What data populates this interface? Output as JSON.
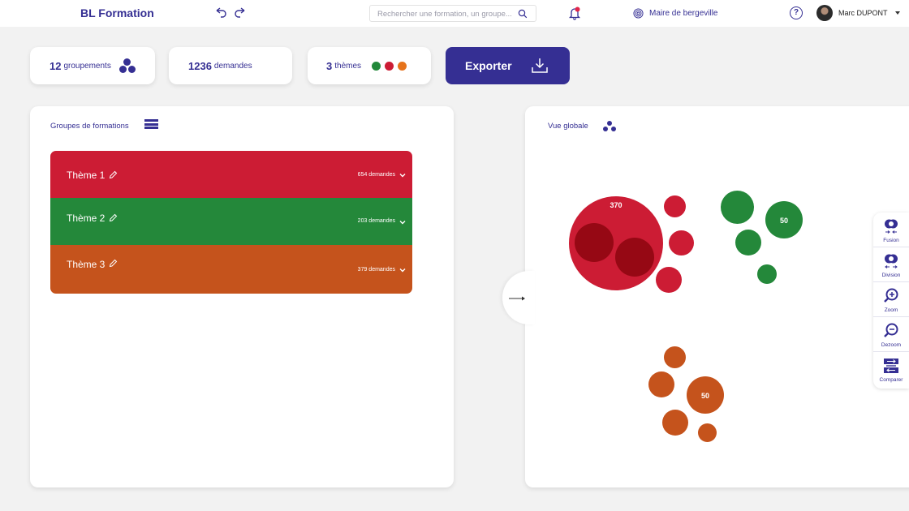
{
  "app": {
    "brand": "BL Formation"
  },
  "header": {
    "search_placeholder": "Rechercher une formation, un groupe...",
    "organization": "Maire de bergeville",
    "help_label": "?",
    "user_name": "Marc DUPONT"
  },
  "stats": {
    "groupements_count": "12",
    "groupements_label": "groupements",
    "demandes_count": "1236",
    "demandes_label": "demandes",
    "themes_count": "3",
    "themes_label": "thèmes",
    "theme_colors": [
      "#22883a",
      "#cc1c34",
      "#e6731b"
    ]
  },
  "export_label": "Exporter",
  "left_panel": {
    "title": "Groupes de formations",
    "themes": [
      {
        "name": "Thème 1",
        "count": "654 demandes",
        "color": "#cc1c34"
      },
      {
        "name": "Thème 2",
        "count": "203 demandes",
        "color": "#24883a"
      },
      {
        "name": "Thème 3",
        "count": "379 demandes",
        "color": "#c5531c"
      }
    ]
  },
  "right_panel": {
    "title": "Vue globale",
    "bubble_labels": {
      "red_big": "370",
      "green_big": "50",
      "orange_big": "50"
    },
    "colors": {
      "red": "#cc1c34",
      "red_dark": "#960814",
      "green": "#24883a",
      "orange": "#c5531c"
    }
  },
  "tools": [
    {
      "label": "Fusion",
      "icon": "fusion-icon"
    },
    {
      "label": "Division",
      "icon": "division-icon"
    },
    {
      "label": "Zoom",
      "icon": "zoom-in-icon"
    },
    {
      "label": "Dezoom",
      "icon": "zoom-out-icon"
    },
    {
      "label": "Comparer",
      "icon": "compare-icon"
    }
  ]
}
